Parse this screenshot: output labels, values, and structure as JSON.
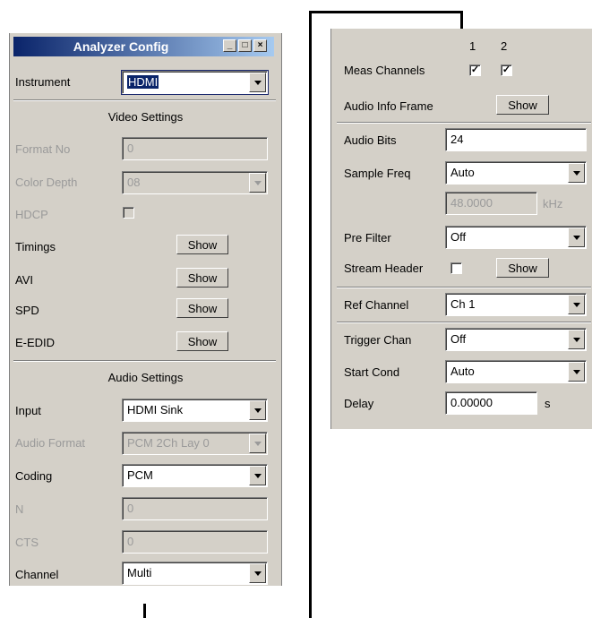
{
  "window": {
    "title": "Analyzer Config",
    "minimize": "_",
    "maximize": "□",
    "close": "×"
  },
  "instrument": {
    "label": "Instrument",
    "value": "HDMI"
  },
  "video": {
    "header": "Video Settings",
    "format_no": {
      "label": "Format No",
      "value": "0"
    },
    "color_depth": {
      "label": "Color Depth",
      "value": "08"
    },
    "hdcp": {
      "label": "HDCP"
    },
    "timings": {
      "label": "Timings",
      "button": "Show"
    },
    "avi": {
      "label": "AVI",
      "button": "Show"
    },
    "spd": {
      "label": "SPD",
      "button": "Show"
    },
    "eedid": {
      "label": "E-EDID",
      "button": "Show"
    }
  },
  "audio": {
    "header": "Audio Settings",
    "input": {
      "label": "Input",
      "value": "HDMI Sink"
    },
    "audio_format": {
      "label": "Audio Format",
      "value": "PCM 2Ch Lay 0"
    },
    "coding": {
      "label": "Coding",
      "value": "PCM"
    },
    "n": {
      "label": "N",
      "value": "0"
    },
    "cts": {
      "label": "CTS",
      "value": "0"
    },
    "channel": {
      "label": "Channel",
      "value": "Multi"
    }
  },
  "right": {
    "col1": "1",
    "col2": "2",
    "meas_channels": {
      "label": "Meas Channels",
      "ch1": "✓",
      "ch2": "✓"
    },
    "audio_info_frame": {
      "label": "Audio Info Frame",
      "button": "Show"
    },
    "audio_bits": {
      "label": "Audio Bits",
      "value": "24"
    },
    "sample_freq": {
      "label": "Sample Freq",
      "value": "Auto",
      "readout": "48.0000",
      "unit": "kHz"
    },
    "pre_filter": {
      "label": "Pre Filter",
      "value": "Off"
    },
    "stream_header": {
      "label": "Stream Header",
      "button": "Show"
    },
    "ref_channel": {
      "label": "Ref Channel",
      "value": "Ch 1"
    },
    "trigger_chan": {
      "label": "Trigger Chan",
      "value": "Off"
    },
    "start_cond": {
      "label": "Start Cond",
      "value": "Auto"
    },
    "delay": {
      "label": "Delay",
      "value": "0.00000",
      "unit": "s"
    }
  }
}
